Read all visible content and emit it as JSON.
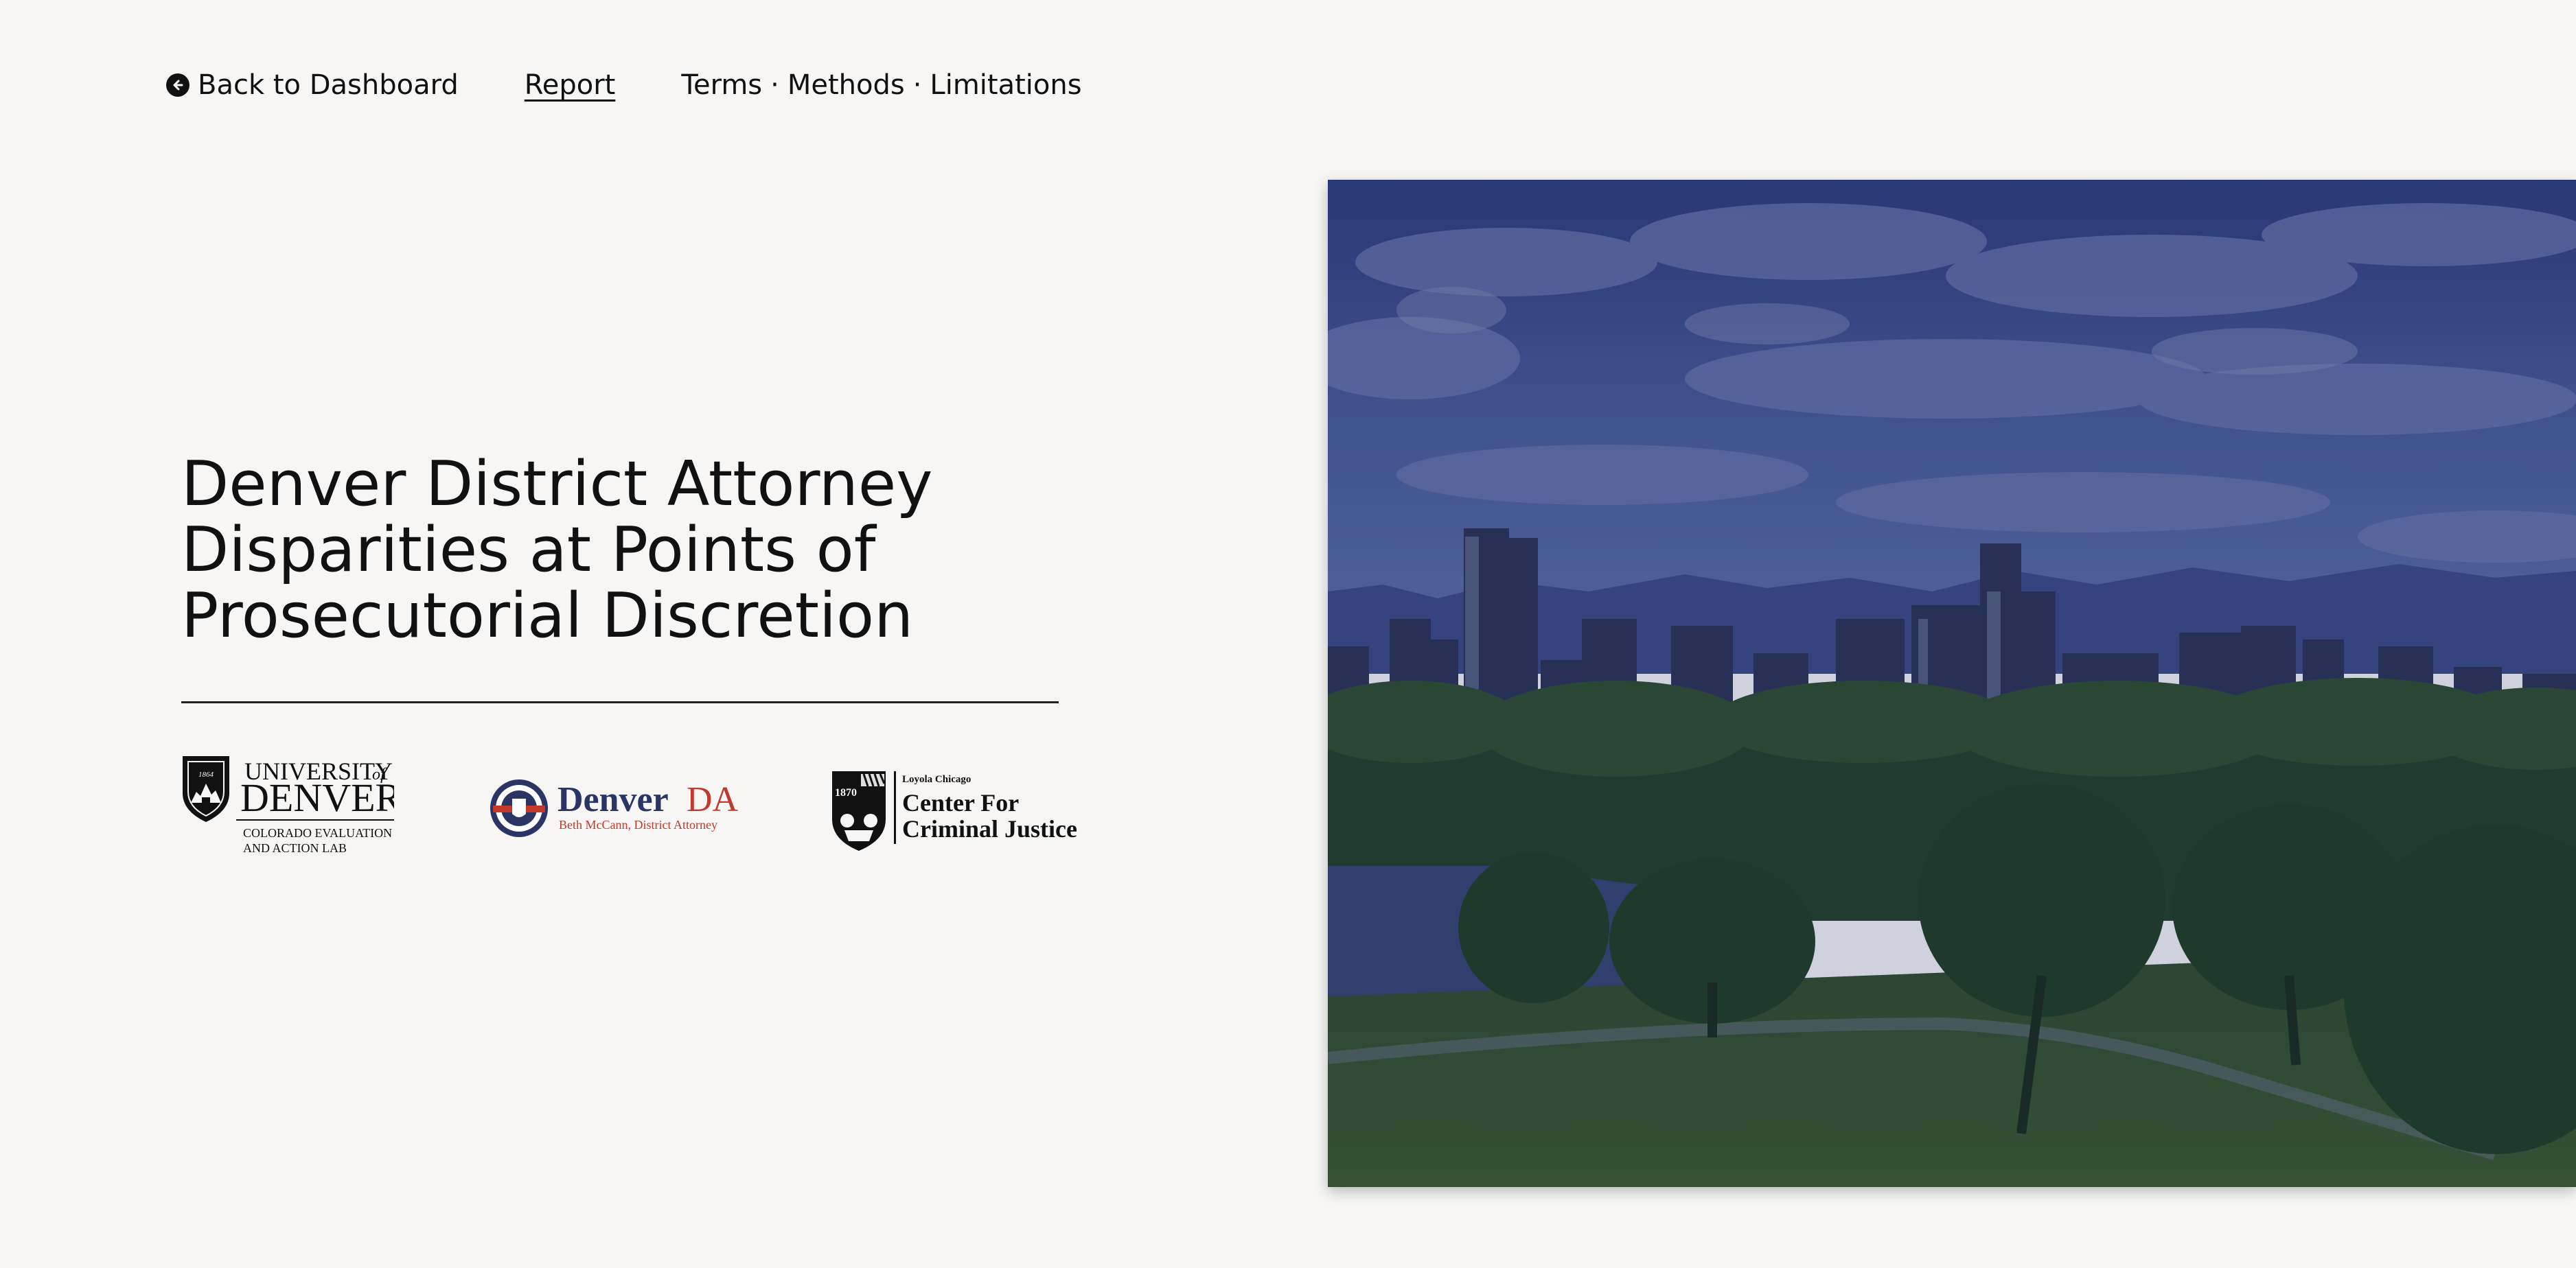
{
  "nav": {
    "back_label": "Back to Dashboard",
    "report_label": "Report",
    "terms_label": "Terms",
    "methods_label": "Methods",
    "limitations_label": "Limitations",
    "separator": "·"
  },
  "hero": {
    "title_line1": "Denver District Attorney",
    "title_line2": "Disparities at Points of",
    "title_line3": "Prosecutorial Discretion"
  },
  "logos": {
    "du": {
      "line1": "UNIVERSITY",
      "of": "of",
      "line2": "DENVER",
      "sub1": "COLORADO EVALUATION",
      "sub2": "AND ACTION LAB",
      "seal_year": "1864"
    },
    "da": {
      "name": "Denver",
      "suffix": "DA",
      "sub": "Beth McCann, District Attorney"
    },
    "lc": {
      "small": "Loyola Chicago",
      "line1": "Center For",
      "line2": "Criminal Justice",
      "year": "1870"
    }
  },
  "colors": {
    "background": "#f7f6f4",
    "text": "#111111",
    "da_navy": "#2a3566",
    "da_red": "#c0392b",
    "hero_overlay": "#1e2a6e"
  },
  "icons": {
    "back": "arrow-left-circle-icon"
  }
}
